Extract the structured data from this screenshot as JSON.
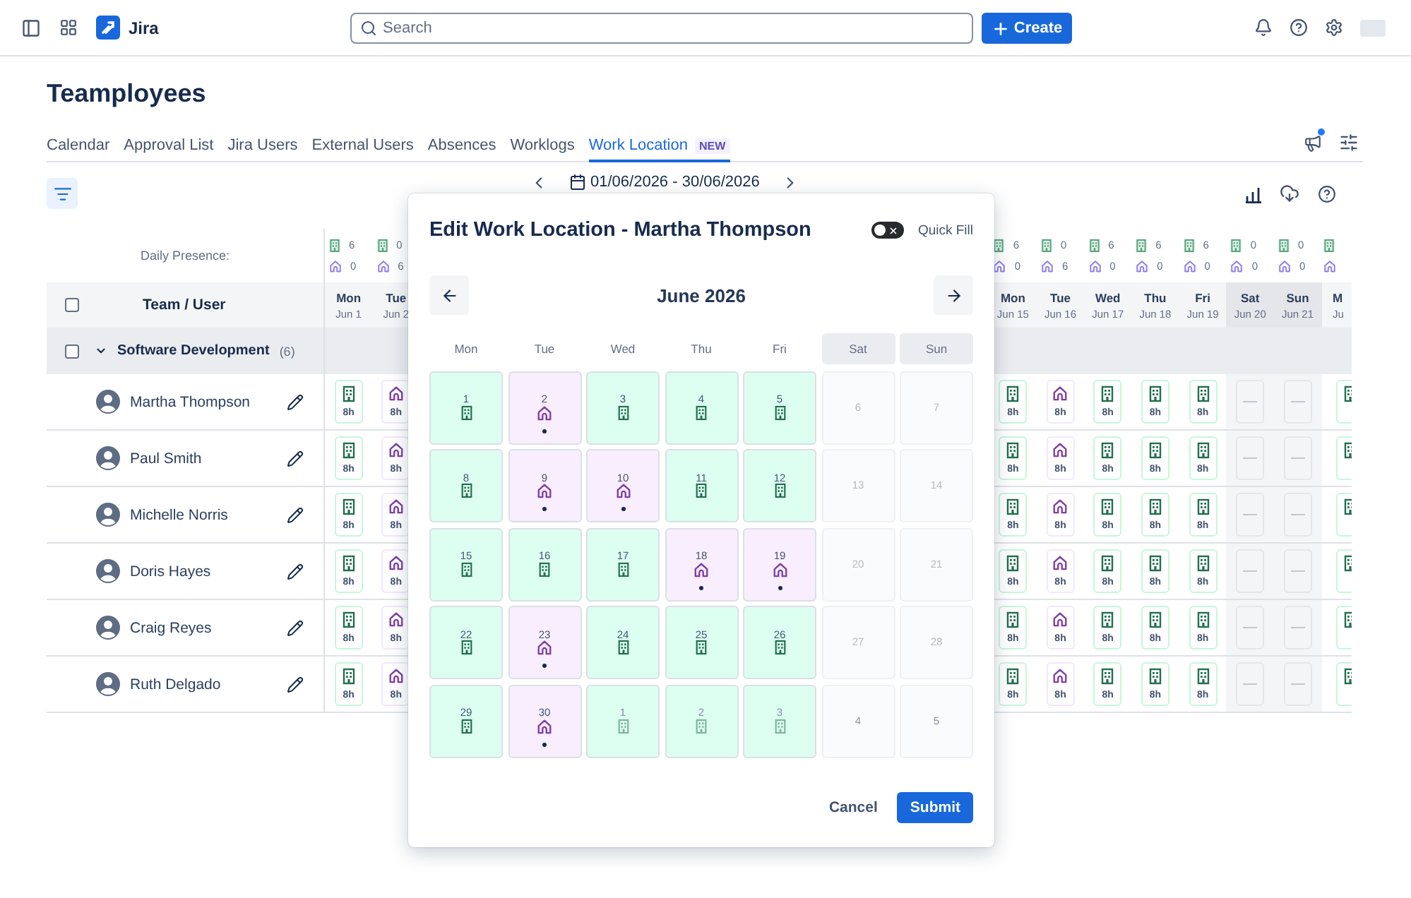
{
  "topbar": {
    "app_name": "Jira",
    "search": {
      "placeholder": "Search"
    },
    "create_label": "Create"
  },
  "page_title": "Teamployees",
  "tabs": [
    {
      "label": "Calendar",
      "selected": false
    },
    {
      "label": "Approval List",
      "selected": false
    },
    {
      "label": "Jira Users",
      "selected": false
    },
    {
      "label": "External Users",
      "selected": false
    },
    {
      "label": "Absences",
      "selected": false
    },
    {
      "label": "Worklogs",
      "selected": false
    },
    {
      "label": "Work Location",
      "selected": true,
      "badge": "NEW"
    }
  ],
  "announcements": {
    "unread": true
  },
  "date_range": {
    "label": "01/06/2026 - 30/06/2026"
  },
  "table": {
    "presence_label": "Daily Presence:",
    "header": {
      "label": "Team / User",
      "checked": false
    },
    "group": {
      "name": "Software Development",
      "count": "(6)",
      "checked": false,
      "expanded": true
    },
    "leading_days": [
      {
        "day": "Mon",
        "date": "Jun 1",
        "office": "6",
        "home": "0",
        "weekend": false
      },
      {
        "day": "Tue",
        "date": "Jun 2",
        "office": "0",
        "home": "6",
        "weekend": false
      }
    ],
    "trailing_days": [
      {
        "day": "Mon",
        "date": "Jun 15",
        "office": "6",
        "home": "0",
        "weekend": false
      },
      {
        "day": "Tue",
        "date": "Jun 16",
        "office": "0",
        "home": "6",
        "weekend": false
      },
      {
        "day": "Wed",
        "date": "Jun 17",
        "office": "6",
        "home": "0",
        "weekend": false
      },
      {
        "day": "Thu",
        "date": "Jun 18",
        "office": "6",
        "home": "0",
        "weekend": false
      },
      {
        "day": "Fri",
        "date": "Jun 19",
        "office": "6",
        "home": "0",
        "weekend": false
      },
      {
        "day": "Sat",
        "date": "Jun 20",
        "office": "0",
        "home": "0",
        "weekend": true
      },
      {
        "day": "Sun",
        "date": "Jun 21",
        "office": "0",
        "home": "0",
        "weekend": true
      },
      {
        "day": "M",
        "date": "Ju",
        "weekend": false,
        "cut": true
      }
    ],
    "users": [
      {
        "name": "Martha Thompson",
        "leading_cells": [
          {
            "kind": "office",
            "hours": "8h"
          },
          {
            "kind": "home",
            "hours": "8h"
          }
        ],
        "trailing_cells": [
          {
            "kind": "office",
            "hours": "8h"
          },
          {
            "kind": "home",
            "hours": "8h"
          },
          {
            "kind": "office",
            "hours": "8h"
          },
          {
            "kind": "office",
            "hours": "8h"
          },
          {
            "kind": "office",
            "hours": "8h"
          },
          {
            "kind": "weekend"
          },
          {
            "kind": "weekend"
          },
          {
            "kind": "office"
          }
        ]
      },
      {
        "name": "Paul Smith",
        "leading_cells": [
          {
            "kind": "office",
            "hours": "8h"
          },
          {
            "kind": "home",
            "hours": "8h"
          }
        ],
        "trailing_cells": [
          {
            "kind": "office",
            "hours": "8h"
          },
          {
            "kind": "home",
            "hours": "8h"
          },
          {
            "kind": "office",
            "hours": "8h"
          },
          {
            "kind": "office",
            "hours": "8h"
          },
          {
            "kind": "office",
            "hours": "8h"
          },
          {
            "kind": "weekend"
          },
          {
            "kind": "weekend"
          },
          {
            "kind": "office"
          }
        ]
      },
      {
        "name": "Michelle Norris",
        "leading_cells": [
          {
            "kind": "office",
            "hours": "8h"
          },
          {
            "kind": "home",
            "hours": "8h"
          }
        ],
        "trailing_cells": [
          {
            "kind": "office",
            "hours": "8h"
          },
          {
            "kind": "home",
            "hours": "8h"
          },
          {
            "kind": "office",
            "hours": "8h"
          },
          {
            "kind": "office",
            "hours": "8h"
          },
          {
            "kind": "office",
            "hours": "8h"
          },
          {
            "kind": "weekend"
          },
          {
            "kind": "weekend"
          },
          {
            "kind": "office"
          }
        ]
      },
      {
        "name": "Doris Hayes",
        "leading_cells": [
          {
            "kind": "office",
            "hours": "8h"
          },
          {
            "kind": "home",
            "hours": "8h"
          }
        ],
        "trailing_cells": [
          {
            "kind": "office",
            "hours": "8h"
          },
          {
            "kind": "home",
            "hours": "8h"
          },
          {
            "kind": "office",
            "hours": "8h"
          },
          {
            "kind": "office",
            "hours": "8h"
          },
          {
            "kind": "office",
            "hours": "8h"
          },
          {
            "kind": "weekend"
          },
          {
            "kind": "weekend"
          },
          {
            "kind": "office"
          }
        ]
      },
      {
        "name": "Craig Reyes",
        "leading_cells": [
          {
            "kind": "office",
            "hours": "8h"
          },
          {
            "kind": "home",
            "hours": "8h"
          }
        ],
        "trailing_cells": [
          {
            "kind": "office",
            "hours": "8h"
          },
          {
            "kind": "home",
            "hours": "8h"
          },
          {
            "kind": "office",
            "hours": "8h"
          },
          {
            "kind": "office",
            "hours": "8h"
          },
          {
            "kind": "office",
            "hours": "8h"
          },
          {
            "kind": "weekend"
          },
          {
            "kind": "weekend"
          },
          {
            "kind": "office"
          }
        ]
      },
      {
        "name": "Ruth Delgado",
        "leading_cells": [
          {
            "kind": "office",
            "hours": "8h"
          },
          {
            "kind": "home",
            "hours": "8h"
          }
        ],
        "trailing_cells": [
          {
            "kind": "office",
            "hours": "8h"
          },
          {
            "kind": "home",
            "hours": "8h"
          },
          {
            "kind": "office",
            "hours": "8h"
          },
          {
            "kind": "office",
            "hours": "8h"
          },
          {
            "kind": "office",
            "hours": "8h"
          },
          {
            "kind": "weekend"
          },
          {
            "kind": "weekend"
          },
          {
            "kind": "office"
          }
        ]
      }
    ]
  },
  "dialog": {
    "title": "Edit Work Location - Martha Thompson",
    "quick_fill": {
      "label": "Quick Fill",
      "on": false
    },
    "month": "June 2026",
    "weekdays": [
      {
        "label": "Mon",
        "weekend": false
      },
      {
        "label": "Tue",
        "weekend": false
      },
      {
        "label": "Wed",
        "weekend": false
      },
      {
        "label": "Thu",
        "weekend": false
      },
      {
        "label": "Fri",
        "weekend": false
      },
      {
        "label": "Sat",
        "weekend": true
      },
      {
        "label": "Sun",
        "weekend": true
      }
    ],
    "weeks": [
      {
        "days": [
          {
            "n": "1",
            "kind": "office",
            "dot": false,
            "in_month": true
          },
          {
            "n": "2",
            "kind": "home",
            "dot": true,
            "in_month": true
          },
          {
            "n": "3",
            "kind": "office",
            "dot": false,
            "in_month": true
          },
          {
            "n": "4",
            "kind": "office",
            "dot": false,
            "in_month": true
          },
          {
            "n": "5",
            "kind": "office",
            "dot": false,
            "in_month": true
          },
          {
            "n": "6",
            "kind": "weekend",
            "dot": false,
            "in_month": true
          },
          {
            "n": "7",
            "kind": "weekend",
            "dot": false,
            "in_month": true
          }
        ]
      },
      {
        "days": [
          {
            "n": "8",
            "kind": "office",
            "dot": false,
            "in_month": true
          },
          {
            "n": "9",
            "kind": "home",
            "dot": true,
            "in_month": true
          },
          {
            "n": "10",
            "kind": "home",
            "dot": true,
            "in_month": true
          },
          {
            "n": "11",
            "kind": "office",
            "dot": false,
            "in_month": true
          },
          {
            "n": "12",
            "kind": "office",
            "dot": false,
            "in_month": true
          },
          {
            "n": "13",
            "kind": "weekend",
            "dot": false,
            "in_month": true
          },
          {
            "n": "14",
            "kind": "weekend",
            "dot": false,
            "in_month": true
          }
        ]
      },
      {
        "days": [
          {
            "n": "15",
            "kind": "office",
            "dot": false,
            "in_month": true
          },
          {
            "n": "16",
            "kind": "office",
            "dot": false,
            "in_month": true
          },
          {
            "n": "17",
            "kind": "office",
            "dot": false,
            "in_month": true
          },
          {
            "n": "18",
            "kind": "home",
            "dot": true,
            "in_month": true
          },
          {
            "n": "19",
            "kind": "home",
            "dot": true,
            "in_month": true
          },
          {
            "n": "20",
            "kind": "weekend",
            "dot": false,
            "in_month": true
          },
          {
            "n": "21",
            "kind": "weekend",
            "dot": false,
            "in_month": true
          }
        ]
      },
      {
        "days": [
          {
            "n": "22",
            "kind": "office",
            "dot": false,
            "in_month": true
          },
          {
            "n": "23",
            "kind": "home",
            "dot": true,
            "in_month": true
          },
          {
            "n": "24",
            "kind": "office",
            "dot": false,
            "in_month": true
          },
          {
            "n": "25",
            "kind": "office",
            "dot": false,
            "in_month": true
          },
          {
            "n": "26",
            "kind": "office",
            "dot": false,
            "in_month": true
          },
          {
            "n": "27",
            "kind": "weekend",
            "dot": false,
            "in_month": true
          },
          {
            "n": "28",
            "kind": "weekend",
            "dot": false,
            "in_month": true
          }
        ]
      },
      {
        "days": [
          {
            "n": "29",
            "kind": "office",
            "dot": false,
            "in_month": true
          },
          {
            "n": "30",
            "kind": "home",
            "dot": true,
            "in_month": true
          },
          {
            "n": "1",
            "kind": "office",
            "dot": false,
            "in_month": false
          },
          {
            "n": "2",
            "kind": "office",
            "dot": false,
            "in_month": false
          },
          {
            "n": "3",
            "kind": "office",
            "dot": false,
            "in_month": false
          },
          {
            "n": "4",
            "kind": "weekend",
            "dot": false,
            "in_month": false
          },
          {
            "n": "5",
            "kind": "weekend",
            "dot": false,
            "in_month": false
          }
        ]
      }
    ],
    "cancel_label": "Cancel",
    "submit_label": "Submit"
  }
}
